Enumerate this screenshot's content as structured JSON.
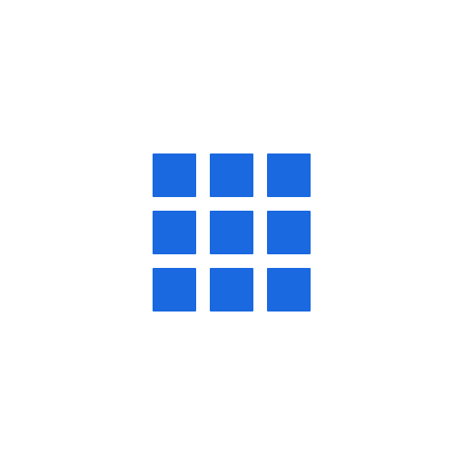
{
  "icon": {
    "name": "apps-grid-icon",
    "color": "#1a69e0",
    "rows": 3,
    "columns": 3
  }
}
